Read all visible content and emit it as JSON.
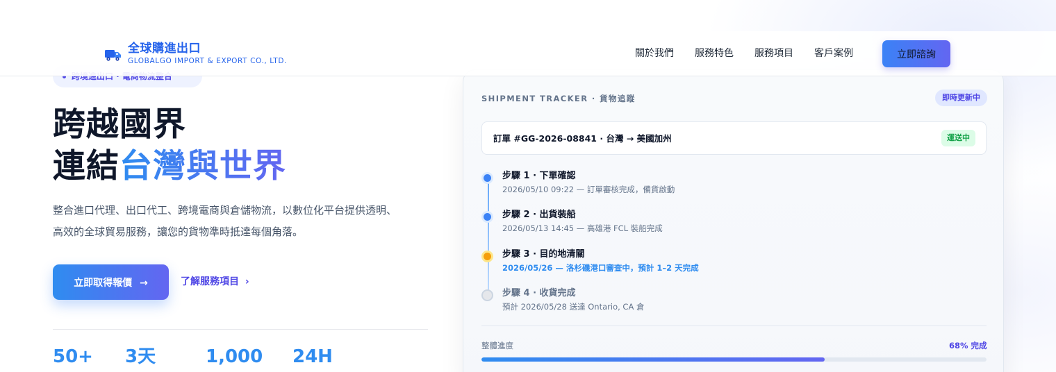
{
  "brand": {
    "name": "全球購進出口",
    "name_en": "GLOBALGO IMPORT & EXPORT CO., LTD.",
    "icon": "truck-icon"
  },
  "nav": {
    "links": [
      "關於我們",
      "服務特色",
      "服務項目",
      "客戶案例"
    ],
    "cta": "立即諮詢"
  },
  "hero": {
    "pill": "跨境進出口 · 電商物流整合",
    "title_line1": "跨越國界",
    "title_line2_prefix": "連結",
    "title_line2_accent": "台灣與世界",
    "description": "整合進口代理、出口代工、跨境電商與倉儲物流，以數位化平台提供透明、高效的全球貿易服務，讓您的貨物準時抵達每個角落。",
    "cta_primary": "立即取得報價",
    "cta_primary_icon": "arrow-right-icon",
    "cta_secondary": "了解服務項目",
    "cta_secondary_icon": "chevron-right-icon"
  },
  "stats": [
    "50+",
    "3天",
    "1,000",
    "24H"
  ],
  "tracker": {
    "label": "SHIPMENT TRACKER · 貨物追蹤",
    "live_badge": "即時更新中",
    "order": "訂單 #GG-2026-08841 · 台灣 → 美國加州",
    "order_status": "運送中",
    "steps": [
      {
        "title": "步驟 1 · 下單確認",
        "detail": "2026/05/10 09:22 — 訂單審核完成，備貨啟動",
        "state": "done"
      },
      {
        "title": "步驟 2 · 出貨裝船",
        "detail": "2026/05/13 14:45 — 高雄港 FCL 裝船完成",
        "state": "done"
      },
      {
        "title": "步驟 3 · 目的地清關",
        "detail": "2026/05/26 — 洛杉磯港口審查中，預計 1–2 天完成",
        "state": "active"
      },
      {
        "title": "步驟 4 · 收貨完成",
        "detail": "預計 2026/05/28 送達 Ontario, CA 倉",
        "state": "pending"
      }
    ],
    "progress_label": "整體進度",
    "progress_text": "68% 完成",
    "progress_value": 0.68
  },
  "colors": {
    "brand_blue": "#2563eb",
    "accent_indigo": "#4f46e5",
    "active_step": "#f59e0b",
    "status_green": "#16a34a"
  }
}
